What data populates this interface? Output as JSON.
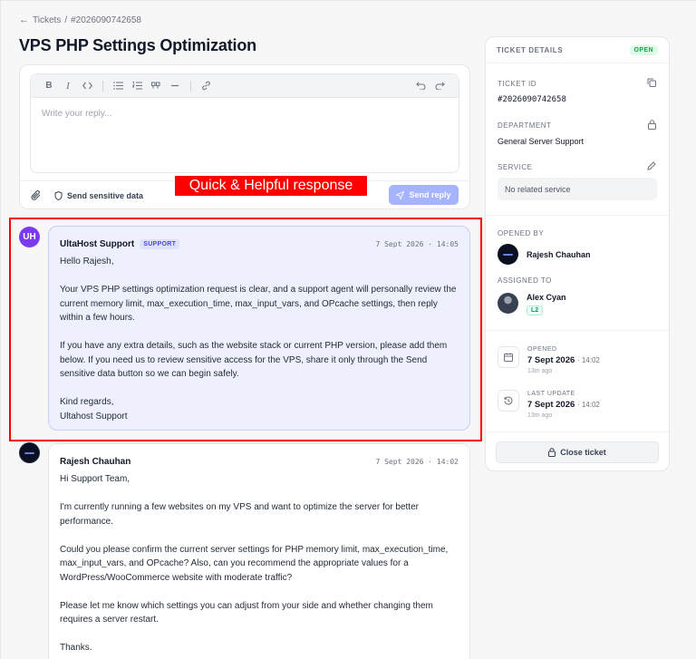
{
  "breadcrumb": {
    "parent": "Tickets",
    "separator": "/",
    "current": "#2026090742658"
  },
  "page_title": "VPS PHP Settings Optimization",
  "editor": {
    "placeholder": "Write your reply...",
    "toolbar_icons": [
      "bold-icon",
      "italic-icon",
      "code-icon",
      "bullet-list-icon",
      "numbered-list-icon",
      "quote-icon",
      "horizontal-rule-icon",
      "link-icon",
      "undo-icon",
      "redo-icon"
    ],
    "bold_label": "B",
    "italic_label": "I"
  },
  "reply_footer": {
    "sensitive_label": "Send sensitive data",
    "send_label": "Send reply"
  },
  "annotation": {
    "text": "Quick & Helpful response",
    "color": "#ff0000"
  },
  "messages": [
    {
      "avatar_initials": "UH",
      "author": "UltaHost Support",
      "badge": "SUPPORT",
      "time": "7 Sept 2026 · 14:05",
      "paragraphs": [
        "Hello Rajesh,",
        "Your VPS PHP settings optimization request is clear, and a support agent will personally review the current memory limit, max_execution_time, max_input_vars, and OPcache settings, then reply within a few hours.",
        "If you have any extra details, such as the website stack or current PHP version, please add them below. If you need us to review sensitive access for the VPS, share it only through the Send sensitive data button so we can begin safely.",
        "Kind regards,\nUltahost Support"
      ]
    },
    {
      "author": "Rajesh Chauhan",
      "time": "7 Sept 2026 · 14:02",
      "paragraphs": [
        "Hi Support Team,",
        "I'm currently running a few websites on my VPS and want to optimize the server for better performance.",
        "Could you please confirm the current server settings for PHP memory limit, max_execution_time, max_input_vars, and OPcache? Also, can you recommend the appropriate values for a WordPress/WooCommerce website with moderate traffic?",
        "Please let me know which settings you can adjust from your side and whether changing them requires a server restart.",
        "Thanks."
      ]
    }
  ],
  "sidebar": {
    "title": "TICKET DETAILS",
    "status": "OPEN",
    "ticket_id_label": "TICKET ID",
    "ticket_id": "#2026090742658",
    "department_label": "DEPARTMENT",
    "department": "General Server Support",
    "service_label": "SERVICE",
    "service": "No related service",
    "opened_by_label": "OPENED BY",
    "opened_by": "Rajesh Chauhan",
    "assigned_to_label": "ASSIGNED TO",
    "assigned_to": "Alex Cyan",
    "assigned_level": "L2",
    "opened_label": "OPENED",
    "opened_date": "7 Sept 2026",
    "opened_time": "· 14:02",
    "opened_ago": "13m ago",
    "updated_label": "LAST UPDATE",
    "updated_date": "7 Sept 2026",
    "updated_time": "· 14:02",
    "updated_ago": "13m ago",
    "close_label": "Close ticket"
  },
  "colors": {
    "accent": "#7c3aed",
    "send_button": "#a5b4fc",
    "open_badge": "#16a34a",
    "support_bubble": "#eef0fd"
  }
}
